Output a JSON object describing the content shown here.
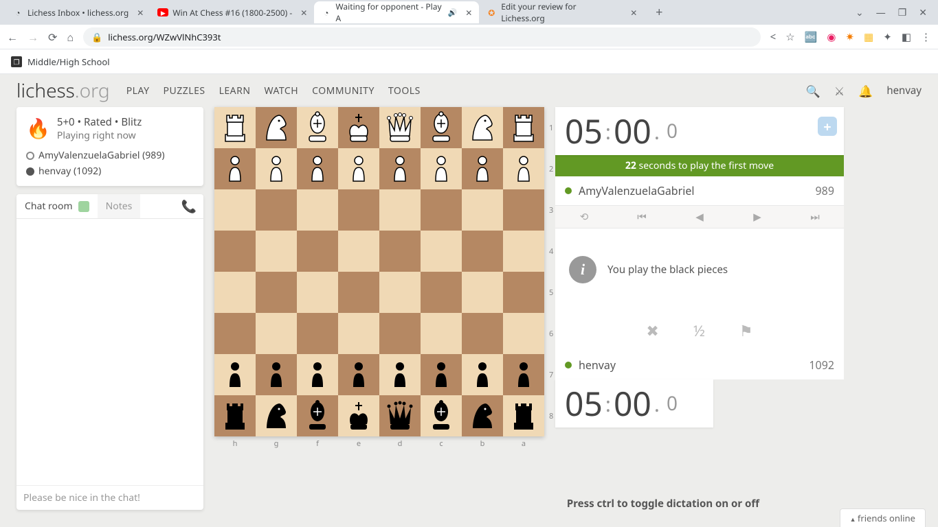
{
  "browser": {
    "tabs": [
      {
        "title": "Lichess Inbox • lichess.org",
        "active": false,
        "icon": "lichess"
      },
      {
        "title": "Win At Chess #16 (1800-2500) -",
        "active": false,
        "icon": "yt"
      },
      {
        "title": "Waiting for opponent - Play A",
        "active": true,
        "icon": "lichess",
        "audio": true
      },
      {
        "title": "Edit your review for Lichess.org",
        "active": false,
        "icon": "star"
      }
    ],
    "url": "lichess.org/WZwVlNhC393t",
    "bookmark": "Middle/High School"
  },
  "header": {
    "logo_main": "lichess",
    "logo_ext": ".org",
    "nav": [
      "PLAY",
      "PUZZLES",
      "LEARN",
      "WATCH",
      "COMMUNITY",
      "TOOLS"
    ],
    "user": "henvay"
  },
  "game_card": {
    "title": "5+0 • Rated • Blitz",
    "subtitle": "Playing right now",
    "opponent": "AmyValenzuelaGabriel (989)",
    "self": "henvay (1092)"
  },
  "chat": {
    "tab1": "Chat room",
    "tab2": "Notes",
    "placeholder": "Please be nice in the chat!"
  },
  "board": {
    "files": [
      "h",
      "g",
      "f",
      "e",
      "d",
      "c",
      "b",
      "a"
    ],
    "ranks": [
      "1",
      "2",
      "3",
      "4",
      "5",
      "6",
      "7",
      "8"
    ]
  },
  "clock_top": {
    "min": "05",
    "sec": "00",
    "tenths": "0"
  },
  "firstmove": {
    "secs": "22",
    "text": " seconds to play the first move"
  },
  "opp_row": {
    "name": "AmyValenzuelaGabriel",
    "rating": "989"
  },
  "info_msg": "You play the black pieces",
  "self_row": {
    "name": "henvay",
    "rating": "1092"
  },
  "clock_bot": {
    "min": "05",
    "sec": "00",
    "tenths": "0"
  },
  "dictation": "Press ctrl to toggle dictation on or off",
  "friends": "friends online"
}
